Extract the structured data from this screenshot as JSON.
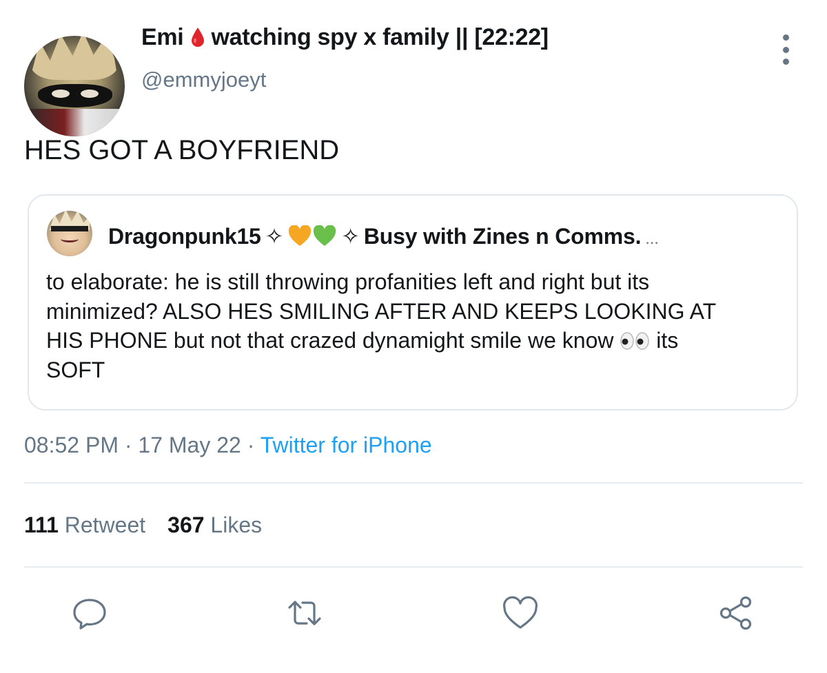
{
  "author": {
    "display_name": "Emi",
    "name_suffix": "watching spy x family || [22:22]",
    "handle": "@emmyjoeyt",
    "drop_icon": "blood-drop-icon"
  },
  "tweet": {
    "text": "HES GOT A BOYFRIEND"
  },
  "quoted_tweet": {
    "display_name_start": "Dragonpunk15",
    "sparkle": "✧",
    "hearts": [
      "orange-heart-icon",
      "green-heart-icon"
    ],
    "name_end": "Busy with Zines n Comms.",
    "ellipsis": "...",
    "body_line1": "to elaborate: he is still throwing profanities left and right but its",
    "body_line2": "minimized? ALSO HES SMILING AFTER AND KEEPS LOOKING AT",
    "body_line3_start": "HIS PHONE but not that crazed dynamight smile we know",
    "body_line3_end": "its",
    "body_line4": "SOFT",
    "eyes_icon": "eyes-emoji-icon"
  },
  "meta": {
    "time": "08:52 PM",
    "separator": "·",
    "date": "17 May 22",
    "source": "Twitter for iPhone"
  },
  "stats": {
    "retweet_count": "111",
    "retweet_label": "Retweet",
    "like_count": "367",
    "like_label": "Likes"
  },
  "actions": {
    "reply_icon": "reply-icon",
    "retweet_icon": "retweet-icon",
    "like_icon": "heart-icon",
    "share_icon": "share-icon"
  },
  "colors": {
    "secondary_text": "#657786",
    "link": "#1da1f2",
    "border": "#e1e8ed"
  }
}
